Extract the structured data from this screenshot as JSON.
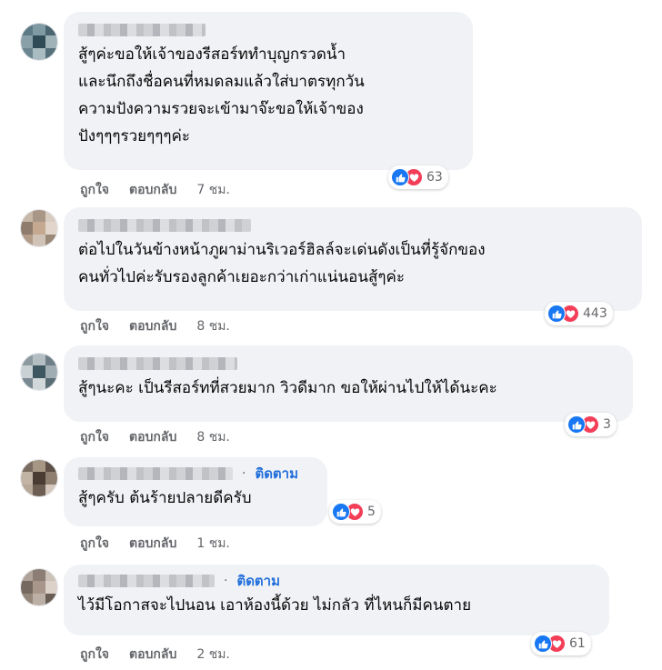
{
  "comments": [
    {
      "text": "สู้ๆค่ะขอให้เจ้าของรีสอร์ททำบุญกรวดน้ำ\nและนึกถึงชื่อคนที่หมดลมแล้วใส่บาตรทุกวัน\nความปังความรวยจะเข้ามาจ๊ะขอให้เจ้าของ\nปังๆๆๆรวยๆๆๆค่ะ",
      "like_label": "ถูกใจ",
      "reply_label": "ตอบกลับ",
      "time": "7 ชม.",
      "reaction_count": "63",
      "follow_label": ""
    },
    {
      "text": "ต่อไปในวันข้างหน้าภูผาม่านริเวอร์ฮิลล์จะเด่นดังเป็นที่รู้จักของ\nคนทั่วไปค่ะรับรองลูกค้าเยอะกว่าเก่าแน่นอนสู้ๆค่ะ",
      "like_label": "ถูกใจ",
      "reply_label": "ตอบกลับ",
      "time": "8 ชม.",
      "reaction_count": "443",
      "follow_label": ""
    },
    {
      "text": "สู้ๆนะคะ เป็นรีสอร์ทที่สวยมาก วิวดีมาก ขอให้ผ่านไปให้ได้นะคะ",
      "like_label": "ถูกใจ",
      "reply_label": "ตอบกลับ",
      "time": "8 ชม.",
      "reaction_count": "3",
      "follow_label": ""
    },
    {
      "text": "สู้ๆครับ ต้นร้ายปลายดีครับ",
      "like_label": "ถูกใจ",
      "reply_label": "ตอบกลับ",
      "time": "1 ชม.",
      "reaction_count": "5",
      "follow_label": "ติดตาม"
    },
    {
      "text": "ไว้มีโอกาสจะไปนอน เอาห้องนี้ด้วย ไม่กลัว ที่ไหนก็มีคนตาย",
      "like_label": "ถูกใจ",
      "reply_label": "ตอบกลับ",
      "time": "2 ชม.",
      "reaction_count": "61",
      "follow_label": "ติดตาม"
    }
  ],
  "separator": "·",
  "icons": {
    "like": "like-icon",
    "love": "love-icon"
  },
  "colors": {
    "like": "#1877f2",
    "love": "#f33e58",
    "follow": "#216fdb",
    "bubble": "#f0f2f5"
  }
}
